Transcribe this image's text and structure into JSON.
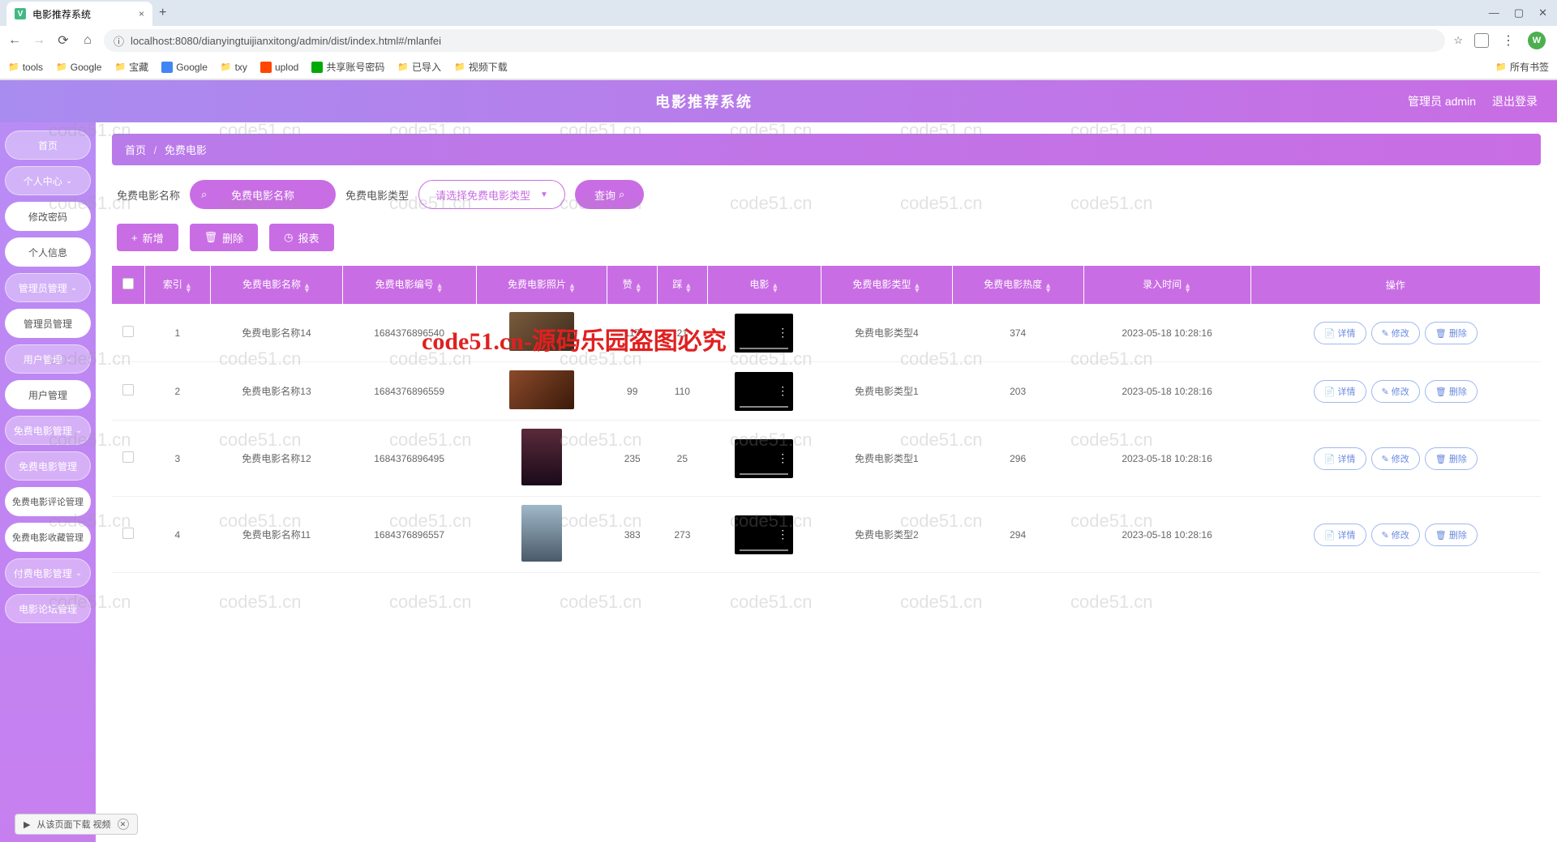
{
  "browser": {
    "tab_title": "电影推荐系统",
    "url": "localhost:8080/dianyingtuijianxitong/admin/dist/index.html#/mlanfei",
    "avatar_letter": "W",
    "bookmarks": [
      "tools",
      "Google",
      "宝藏",
      "Google",
      "txy",
      "uplod",
      "共享账号密码",
      "已导入",
      "视频下载"
    ],
    "bookmark_right": "所有书签"
  },
  "header": {
    "title": "电影推荐系统",
    "user": "管理员 admin",
    "logout": "退出登录"
  },
  "sidebar": {
    "items": [
      {
        "label": "首页",
        "type": "primary"
      },
      {
        "label": "个人中心",
        "type": "primary",
        "chev": true
      },
      {
        "label": "修改密码",
        "type": "white"
      },
      {
        "label": "个人信息",
        "type": "white"
      },
      {
        "label": "管理员管理",
        "type": "primary",
        "chev": true
      },
      {
        "label": "管理员管理",
        "type": "white"
      },
      {
        "label": "用户管理",
        "type": "primary",
        "chev": true
      },
      {
        "label": "用户管理",
        "type": "white"
      },
      {
        "label": "免费电影管理",
        "type": "primary",
        "chev": true
      },
      {
        "label": "免费电影管理",
        "type": "primary"
      },
      {
        "label": "免费电影评论管理",
        "type": "white",
        "long": true
      },
      {
        "label": "免费电影收藏管理",
        "type": "white",
        "long": true
      },
      {
        "label": "付费电影管理",
        "type": "primary",
        "chev": true
      },
      {
        "label": "电影论坛管理",
        "type": "primary"
      }
    ]
  },
  "breadcrumb": {
    "home": "首页",
    "current": "免费电影"
  },
  "search": {
    "name_label": "免费电影名称",
    "name_placeholder": "免费电影名称",
    "type_label": "免费电影类型",
    "type_placeholder": "请选择免费电影类型",
    "query_btn": "查询"
  },
  "actions": {
    "add": "新增",
    "delete": "删除",
    "report": "报表"
  },
  "table": {
    "headers": [
      "",
      "索引",
      "免费电影名称",
      "免费电影编号",
      "免费电影照片",
      "赞",
      "踩",
      "电影",
      "免费电影类型",
      "免费电影热度",
      "录入时间",
      "操作"
    ],
    "ops": {
      "detail": "详情",
      "edit": "修改",
      "delete": "删除"
    },
    "rows": [
      {
        "idx": "1",
        "name": "免费电影名称14",
        "code": "1684376896540",
        "like": "117",
        "dislike": "21",
        "type": "免费电影类型4",
        "hot": "374",
        "time": "2023-05-18 10:28:16",
        "thumb": ""
      },
      {
        "idx": "2",
        "name": "免费电影名称13",
        "code": "1684376896559",
        "like": "99",
        "dislike": "110",
        "type": "免费电影类型1",
        "hot": "203",
        "time": "2023-05-18 10:28:16",
        "thumb": "t2"
      },
      {
        "idx": "3",
        "name": "免费电影名称12",
        "code": "1684376896495",
        "like": "235",
        "dislike": "25",
        "type": "免费电影类型1",
        "hot": "296",
        "time": "2023-05-18 10:28:16",
        "thumb": "t3"
      },
      {
        "idx": "4",
        "name": "免费电影名称11",
        "code": "1684376896557",
        "like": "383",
        "dislike": "273",
        "type": "免费电影类型2",
        "hot": "294",
        "time": "2023-05-18 10:28:16",
        "thumb": "t4"
      }
    ]
  },
  "watermark": "code51.cn",
  "watermark_red": "code51.cn-源码乐园盗图必究",
  "download_bar": "从该页面下载 视频"
}
